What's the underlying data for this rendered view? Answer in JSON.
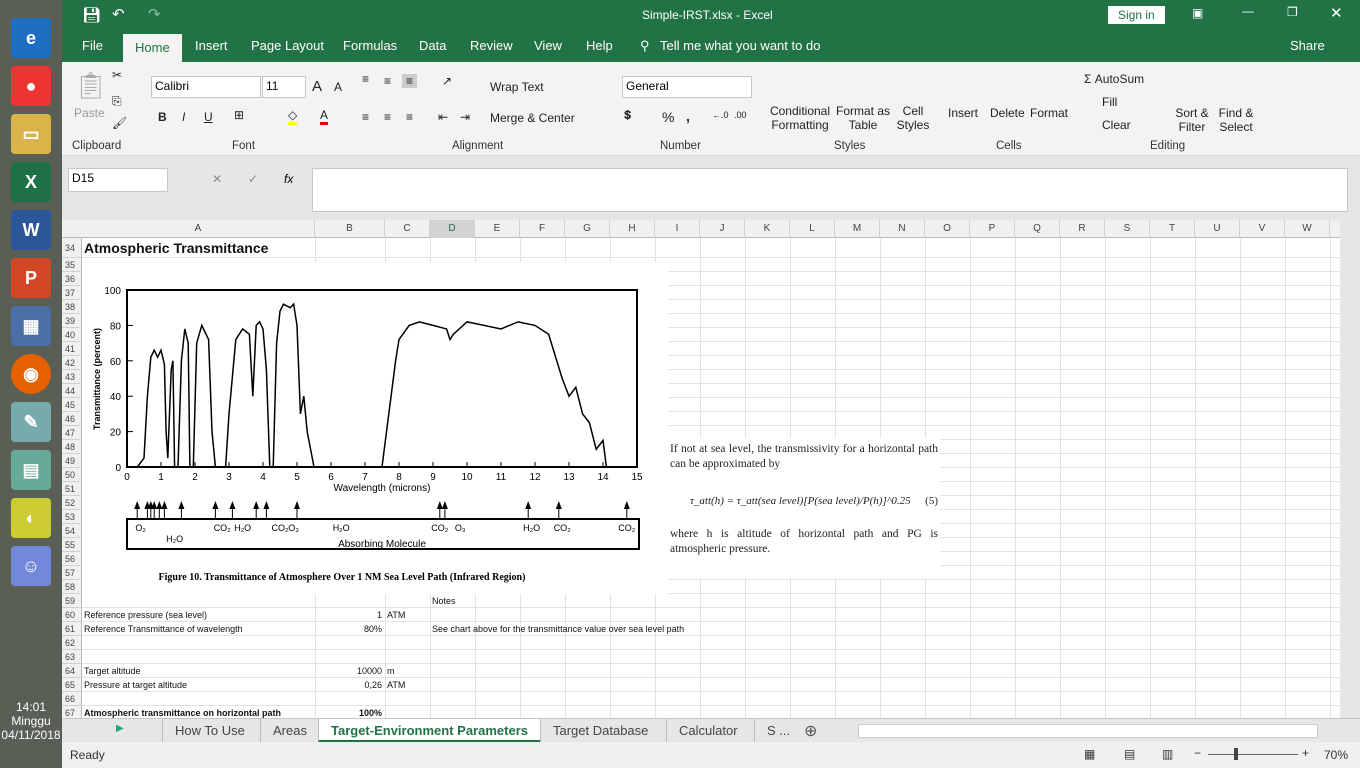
{
  "taskbar": {
    "time": "14:01",
    "day": "Minggu",
    "date": "04/11/2018"
  },
  "title": {
    "doc": "Simple-IRST.xlsx - Excel",
    "sign_in": "Sign in"
  },
  "tabs": [
    "File",
    "Home",
    "Insert",
    "Page Layout",
    "Formulas",
    "Data",
    "Review",
    "View",
    "Help"
  ],
  "tell_me": "Tell me what you want to do",
  "share": "Share",
  "ribbon": {
    "paste": "Paste",
    "font_name": "Calibri",
    "font_size": "11",
    "bold": "B",
    "italic": "I",
    "underline": "U",
    "wrap_text": "Wrap Text",
    "merge_center": "Merge & Center",
    "number_format": "General",
    "percent": "%",
    "comma": ",",
    "cond_fmt": "Conditional Formatting",
    "format_table": "Format as Table",
    "cell_styles": "Cell Styles",
    "insert": "Insert",
    "delete": "Delete",
    "format": "Format",
    "autosum": "AutoSum",
    "fill": "Fill",
    "clear": "Clear",
    "sort_filter": "Sort & Filter",
    "find_select": "Find & Select",
    "groups": [
      "Clipboard",
      "Font",
      "Alignment",
      "Number",
      "Styles",
      "Cells",
      "Editing"
    ]
  },
  "name_box": "D15",
  "fx": "fx",
  "columns": [
    "A",
    "B",
    "C",
    "D",
    "E",
    "F",
    "G",
    "H",
    "I",
    "J",
    "K",
    "L",
    "M",
    "N",
    "O",
    "P",
    "Q",
    "R",
    "S",
    "T",
    "U",
    "V",
    "W"
  ],
  "rows": [
    "34",
    "35",
    "36",
    "37",
    "38",
    "39",
    "40",
    "41",
    "42",
    "43",
    "44",
    "45",
    "46",
    "47",
    "48",
    "49",
    "50",
    "51",
    "52",
    "53",
    "54",
    "55",
    "56",
    "57",
    "58",
    "59",
    "60",
    "61",
    "62",
    "63",
    "64",
    "65",
    "66",
    "67"
  ],
  "heading": "Atmospheric Transmittance",
  "cells": {
    "notes": "Notes",
    "r60a": "Reference pressure (sea level)",
    "r60b": "1",
    "r60c": "ATM",
    "r61a": "Reference Transmittance of wavelength",
    "r61b": "80%",
    "r61d": "See chart above for the transmittance value over sea level path",
    "r64a": "Target altitude",
    "r64b": "10000",
    "r64c": "m",
    "r65a": "Pressure at target altitude",
    "r65b": "0,26",
    "r65c": "ATM",
    "r67a": "Atmospheric transmittance on horizontal path",
    "r67b": "100%"
  },
  "figure": {
    "ylabel": "Transmittance (percent)",
    "xlabel": "Wavelength (microns)",
    "yticks": [
      "0",
      "20",
      "40",
      "60",
      "80",
      "100"
    ],
    "xticks": [
      "0",
      "1",
      "2",
      "3",
      "4",
      "5",
      "6",
      "7",
      "8",
      "9",
      "10",
      "11",
      "12",
      "13",
      "14",
      "15"
    ],
    "molecules_label": "Absorbing Molecule",
    "caption": "Figure 10.  Transmittance of Atmosphere Over 1 NM Sea Level Path (Infrared Region)",
    "molecules": [
      {
        "t": "O₂",
        "x": 0.4
      },
      {
        "t": "H₂O",
        "x": 1.4
      },
      {
        "t": "CO₂",
        "x": 2.8
      },
      {
        "t": "H₂O",
        "x": 3.4
      },
      {
        "t": "CO₂",
        "x": 4.5
      },
      {
        "t": "O₃",
        "x": 4.9
      },
      {
        "t": "H₂O",
        "x": 6.3
      },
      {
        "t": "CO₂",
        "x": 9.2
      },
      {
        "t": "O₃",
        "x": 9.8
      },
      {
        "t": "H₂O",
        "x": 11.9
      },
      {
        "t": "CO₂",
        "x": 12.8
      },
      {
        "t": "CO₂",
        "x": 14.7
      }
    ]
  },
  "formula_text": {
    "p1": "If not at sea level, the transmissivity for a horizontal path can be approximated by",
    "eq": "τ_att(h) = τ_att(sea level)[P(sea level)/P(h)]^0.25",
    "eqnum": "(5)",
    "p2": "where h is altitude of horizontal path and PG is atmospheric pressure."
  },
  "sheets": [
    "How To Use",
    "Areas",
    "Target-Environment Parameters",
    "Target Database",
    "Calculator",
    "S ..."
  ],
  "status": {
    "ready": "Ready",
    "zoom": "70%"
  },
  "colors": {
    "excel_green": "#217346"
  }
}
